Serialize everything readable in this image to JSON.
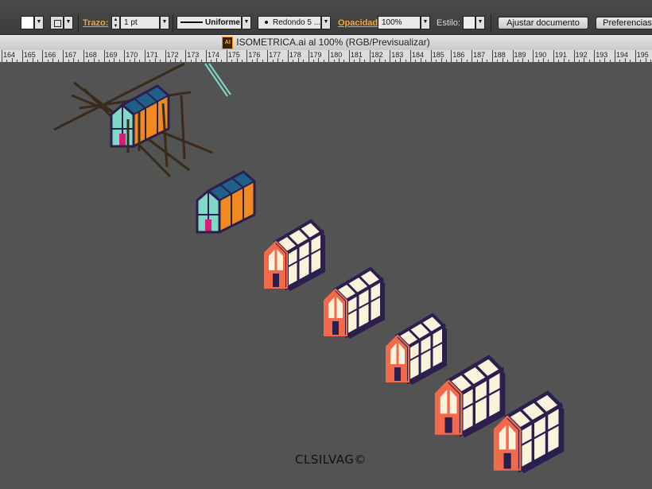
{
  "control_bar": {
    "fill_color": "#ffffff",
    "stroke_label": "Trazo:",
    "stroke_weight": "1 pt",
    "stroke_profile": "Uniforme",
    "brush": "Redondo 5 ...",
    "opacity_label": "Opacidad:",
    "opacity_value": "100%",
    "style_label": "Estilo:",
    "fit_document_button": "Ajustar documento",
    "preferences_button": "Preferencias"
  },
  "document": {
    "title": "ISOMETRICA.ai al 100% (RGB/Previsualizar)",
    "file_icon": "AI"
  },
  "ruler": {
    "labels": [
      "164",
      "165",
      "166",
      "167",
      "168",
      "169",
      "170",
      "171",
      "172",
      "173",
      "174",
      "175",
      "176",
      "177",
      "178",
      "179",
      "180",
      "181",
      "182",
      "183",
      "184",
      "185",
      "186",
      "187",
      "188",
      "189",
      "190",
      "191",
      "192",
      "193",
      "194",
      "195"
    ]
  },
  "artwork": {
    "signature": "CLSILVAG©",
    "colors": {
      "background": "#535353",
      "teal": "#7fd9c6",
      "blue": "#1f5f8a",
      "orange": "#f08a1f",
      "magenta": "#e0187a",
      "navy": "#2a1f4d",
      "coral": "#f26a4a",
      "cream": "#fbf2dc",
      "beam": "#3a2a1a"
    }
  }
}
